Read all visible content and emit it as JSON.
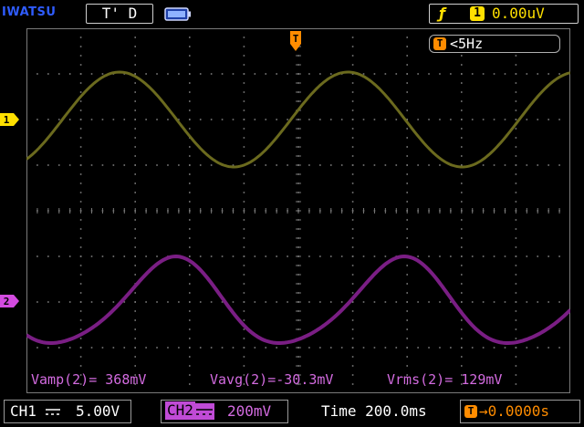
{
  "header": {
    "brand": "IWATSU",
    "trigger_status": "T' D",
    "battery_icon": "battery-icon",
    "trigger_edge_icon": "rising-edge-icon",
    "trigger_source": "1",
    "trigger_level": "0.00uV"
  },
  "screen": {
    "frequency_icon": "T",
    "frequency": "<5Hz",
    "trigger_position_marker": "T",
    "ch1_marker": "1",
    "ch2_marker": "2"
  },
  "measurements": [
    {
      "text": "Vamp(2)= 368mV"
    },
    {
      "text": "Vavg(2)=-30.3mV"
    },
    {
      "text": "Vrms(2)= 129mV"
    }
  ],
  "footer": {
    "ch1_label": "CH1",
    "ch1_scale": "5.00V",
    "ch2_label": "CH2",
    "ch2_scale": "200mV",
    "timebase": "Time 200.0ms",
    "offset_icon": "T",
    "offset": "→0.0000s"
  },
  "colors": {
    "ch1": "#6b6a1e",
    "ch2": "#7a1e84",
    "grid": "#7a7a7a",
    "trigger": "#ff8c00",
    "accent": "#ffe000"
  }
}
